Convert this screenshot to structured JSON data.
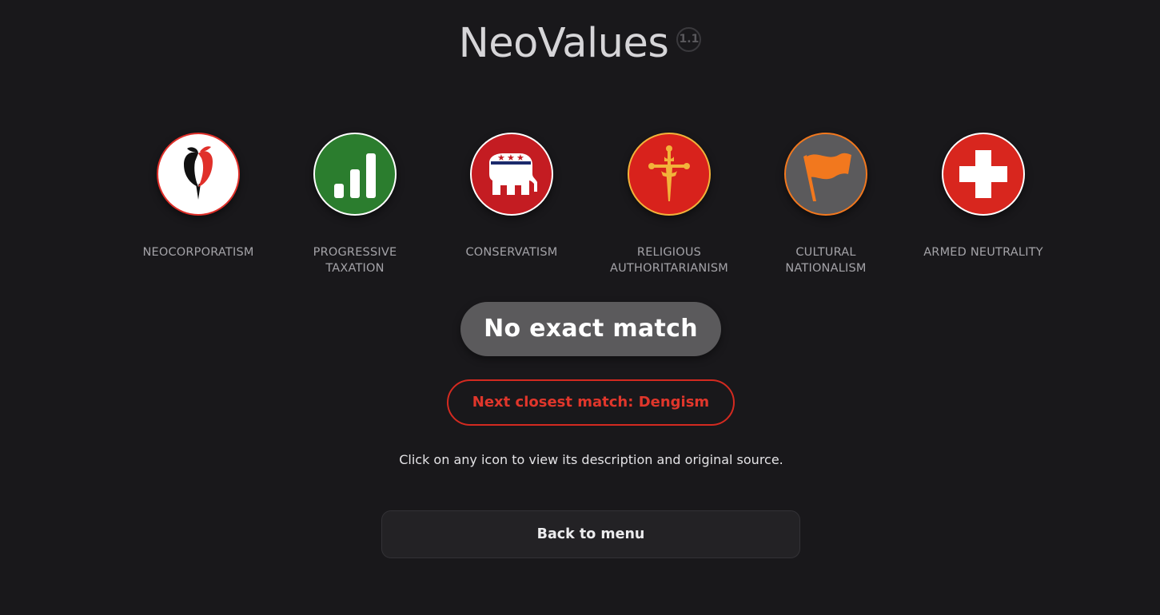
{
  "header": {
    "title": "NeoValues",
    "version": "1.1"
  },
  "ideologies": [
    {
      "label": "NEOCORPORATISM",
      "icon": "tulip-icon",
      "bg": "#ffffff",
      "border": "#e0302a"
    },
    {
      "label": "PROGRESSIVE TAXATION",
      "icon": "bar-chart-icon",
      "bg": "#2b7d2e",
      "border": "#ffffff"
    },
    {
      "label": "CONSERVATISM",
      "icon": "elephant-icon",
      "bg": "#c41c22",
      "border": "#ffffff"
    },
    {
      "label": "RELIGIOUS AUTHORITARIANISM",
      "icon": "cross-of-santiago-icon",
      "bg": "#d8221c",
      "border": "#f2b33a"
    },
    {
      "label": "CULTURAL NATIONALISM",
      "icon": "flag-icon",
      "bg": "#5b5a5c",
      "border": "#f2781e"
    },
    {
      "label": "ARMED NEUTRALITY",
      "icon": "swiss-cross-icon",
      "bg": "#d8261e",
      "border": "#ffffff"
    }
  ],
  "result": {
    "match_text": "No exact match",
    "next_match_text": "Next closest match: Dengism"
  },
  "hint": "Click on any icon to view its description and original source.",
  "back_button": "Back to menu",
  "colors": {
    "background": "#19181b",
    "accent_red": "#d42a20",
    "pill_grey": "#5b5a5c"
  }
}
